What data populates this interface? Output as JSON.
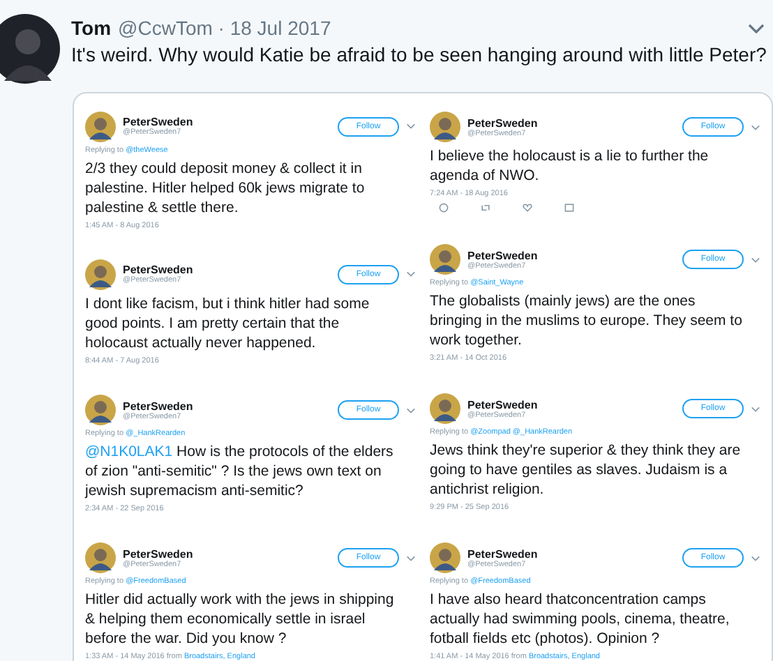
{
  "tweet": {
    "name": "Tom",
    "meta": "@CcwTom · 18 Jul 2017",
    "text": "It's weird. Why would Katie be afraid to be seen hanging around with little Peter?"
  },
  "embed": {
    "columns": [
      {
        "tweets": [
          {
            "name": "PeterSweden",
            "handle": "@PeterSweden7",
            "follow": "Follow",
            "reply_prefix": "Replying to",
            "reply_to": [
              "@theWeese"
            ],
            "text": "2/3 they could deposit money & collect it in palestine. Hitler helped 60k jews migrate to palestine & settle there.",
            "time": "1:45 AM - 8 Aug 2016",
            "actions": false
          },
          {
            "name": "PeterSweden",
            "handle": "@PeterSweden7",
            "follow": "Follow",
            "text": "I dont like facism, but i think hitler had some good points. I am pretty certain that the holocaust actually never happened.",
            "time": "8:44 AM - 7 Aug 2016",
            "actions": false
          },
          {
            "name": "PeterSweden",
            "handle": "@PeterSweden7",
            "follow": "Follow",
            "reply_prefix": "Replying to",
            "reply_to": [
              "@_HankRearden"
            ],
            "mention": "@N1K0LAK1",
            "text": "How is the protocols of the elders of zion \"anti-semitic\" ? Is the jews own text on jewish supremacism anti-semitic?",
            "time": "2:34 AM - 22 Sep 2016",
            "actions": false
          },
          {
            "name": "PeterSweden",
            "handle": "@PeterSweden7",
            "follow": "Follow",
            "reply_prefix": "Replying to",
            "reply_to": [
              "@FreedomBased"
            ],
            "text": "Hitler did actually work with the jews in shipping & helping them economically settle in israel before the war. Did you know ?",
            "time": "1:33 AM - 14 May 2016 from",
            "location": "Broadstairs, England",
            "actions": false
          }
        ]
      },
      {
        "tweets": [
          {
            "name": "PeterSweden",
            "handle": "@PeterSweden7",
            "follow": "Follow",
            "text": "I believe the holocaust is a lie to further the agenda of NWO.",
            "time": "7:24 AM - 18 Aug 2016",
            "actions": true
          },
          {
            "name": "PeterSweden",
            "handle": "@PeterSweden7",
            "follow": "Follow",
            "reply_prefix": "Replying to",
            "reply_to": [
              "@Saint_Wayne"
            ],
            "text": "The globalists (mainly jews) are the ones bringing in the muslims to europe. They seem to work together.",
            "time": "3:21 AM - 14 Oct 2016",
            "actions": false
          },
          {
            "name": "PeterSweden",
            "handle": "@PeterSweden7",
            "follow": "Follow",
            "reply_prefix": "Replying to",
            "reply_to": [
              "@Zoompad",
              "@_HankRearden"
            ],
            "text": "Jews think they're superior & they think they are going to have gentiles as slaves. Judaism is a antichrist religion.",
            "time": "9:29 PM - 25 Sep 2016",
            "actions": false
          },
          {
            "name": "PeterSweden",
            "handle": "@PeterSweden7",
            "follow": "Follow",
            "reply_prefix": "Replying to",
            "reply_to": [
              "@FreedomBased"
            ],
            "text": "I have also heard thatconcentration camps actually had swimming pools, cinema, theatre, fotball fields etc (photos). Opinion ?",
            "time": "1:41 AM - 14 May 2016 from",
            "location": "Broadstairs, England",
            "actions": false
          }
        ]
      }
    ]
  }
}
